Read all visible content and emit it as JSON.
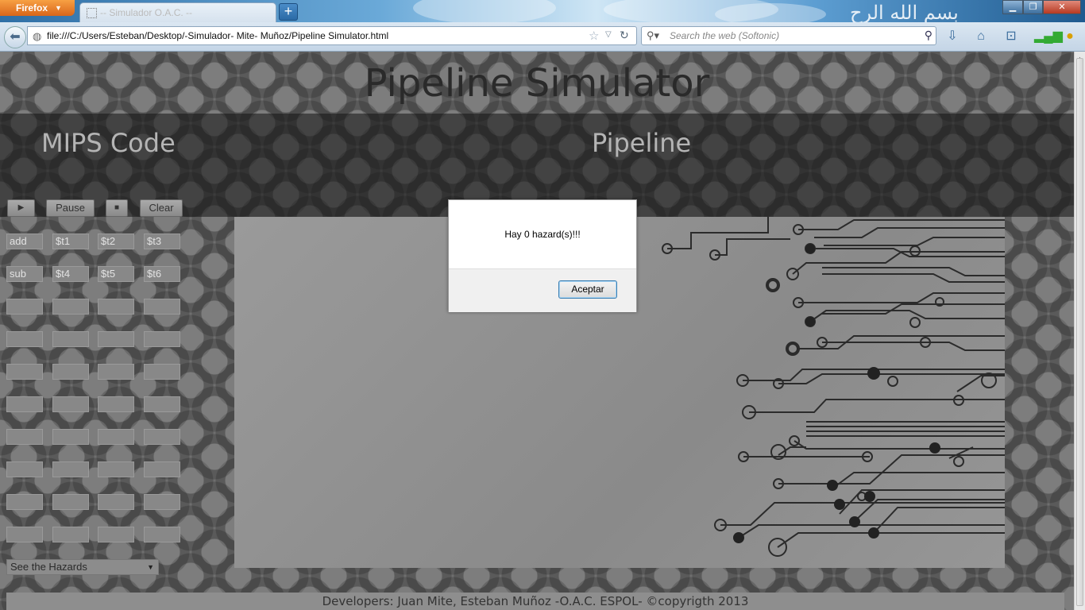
{
  "browser": {
    "app_button": "Firefox",
    "tab_title": "-- Simulador O.A.C. --",
    "new_tab_symbol": "+",
    "url": "file:///C:/Users/Esteban/Desktop/-Simulador- Mite- Muñoz/Pipeline Simulator.html",
    "search_placeholder": "Search the web (Softonic)",
    "header_decoration_text": "بسم الله الرح"
  },
  "page": {
    "title": "Pipeline Simulator",
    "left_section_title": "MIPS Code",
    "right_section_title": "Pipeline",
    "controls": {
      "play": "▶",
      "pause": "Pause",
      "stop": "■",
      "clear": "Clear"
    },
    "instructions": [
      [
        "add",
        "$t1",
        "$t2",
        "$t3"
      ],
      [
        "sub",
        "$t4",
        "$t5",
        "$t6"
      ],
      [
        "",
        "",
        "",
        ""
      ],
      [
        "",
        "",
        "",
        ""
      ],
      [
        "",
        "",
        "",
        ""
      ],
      [
        "",
        "",
        "",
        ""
      ],
      [
        "",
        "",
        "",
        ""
      ],
      [
        "",
        "",
        "",
        ""
      ],
      [
        "",
        "",
        "",
        ""
      ],
      [
        "",
        "",
        "",
        ""
      ]
    ],
    "hazards_select": "See the Hazards",
    "footer": "Developers: Juan Mite, Esteban Muñoz -O.A.C. ESPOL- ©copyrigth 2013"
  },
  "dialog": {
    "message": "Hay 0 hazard(s)!!!",
    "ok_label": "Aceptar"
  },
  "colors": {
    "accent_button_border": "#3c7fb1",
    "firefox_orange": "#e8782a"
  }
}
